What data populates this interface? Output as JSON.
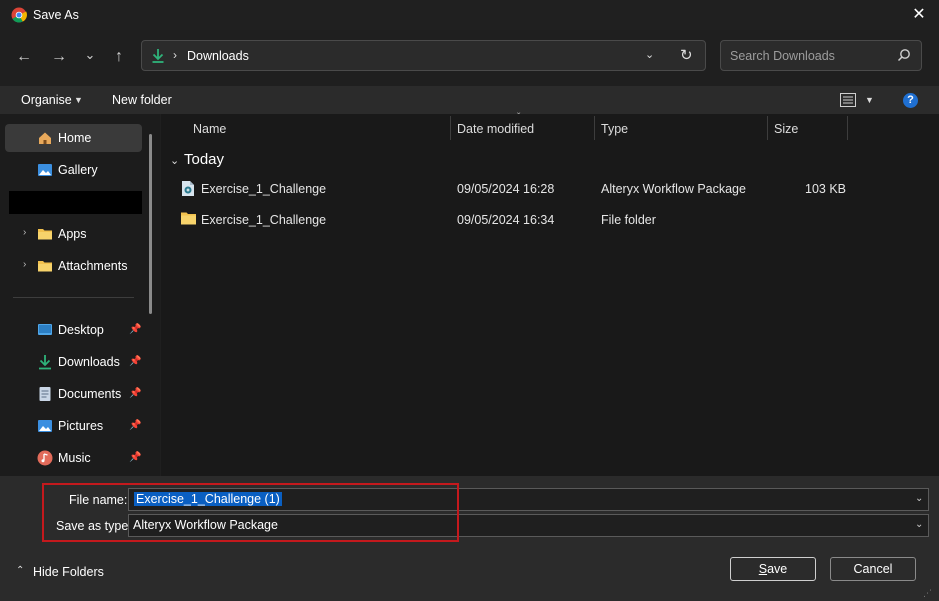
{
  "window": {
    "title": "Save As",
    "close_glyph": "✕",
    "icon": "chrome-icon"
  },
  "nav": {
    "back_glyph": "←",
    "forward_glyph": "→",
    "recent_glyph": "⌄",
    "up_glyph": "↑",
    "address": {
      "path_label": "Downloads",
      "sep_glyph": "›",
      "dropdown_glyph": "⌄",
      "refresh_glyph": "↻"
    },
    "search": {
      "placeholder": "Search Downloads",
      "icon": "search-icon"
    }
  },
  "toolbar": {
    "organise_label": "Organise",
    "caret_glyph": "▼",
    "new_folder_label": "New folder",
    "view_icon": "details-view-icon",
    "help_glyph": "?"
  },
  "sidebar": {
    "items": [
      {
        "label": "Home",
        "icon": "home-icon"
      },
      {
        "label": "Gallery",
        "icon": "gallery-icon"
      },
      {
        "label": "Apps",
        "icon": "folder-icon",
        "expandable": true
      },
      {
        "label": "Attachments",
        "icon": "folder-icon",
        "expandable": true
      },
      {
        "label": "Desktop",
        "icon": "desktop-icon",
        "pinned": true
      },
      {
        "label": "Downloads",
        "icon": "download-icon",
        "pinned": true
      },
      {
        "label": "Documents",
        "icon": "documents-icon",
        "pinned": true
      },
      {
        "label": "Pictures",
        "icon": "pictures-icon",
        "pinned": true
      },
      {
        "label": "Music",
        "icon": "music-icon",
        "pinned": true
      }
    ],
    "expand_glyph": "›",
    "pin_glyph": "📌"
  },
  "files": {
    "columns": [
      "Name",
      "Date modified",
      "Type",
      "Size"
    ],
    "sort_glyph": "ˇ",
    "group_label": "Today",
    "group_chev": "⌄",
    "rows": [
      {
        "name": "Exercise_1_Challenge",
        "date": "09/05/2024 16:28",
        "type": "Alteryx Workflow Package",
        "size": "103 KB",
        "icon": "alteryx-package-icon"
      },
      {
        "name": "Exercise_1_Challenge",
        "date": "09/05/2024 16:34",
        "type": "File folder",
        "size": "",
        "icon": "folder-icon"
      }
    ]
  },
  "form": {
    "file_name_label": "File name:",
    "file_name_value": "Exercise_1_Challenge (1)",
    "save_type_label": "Save as type:",
    "save_type_value": "Alteryx Workflow Package",
    "dropdown_glyph": "⌄",
    "highlight_color": "#c4191d"
  },
  "footer": {
    "hide_folders_label": "Hide Folders",
    "hide_caret": "⌃",
    "save_label_first": "S",
    "save_label_rest": "ave",
    "cancel_label": "Cancel"
  },
  "colors": {
    "selection": "#0a5fc2",
    "help": "#1f6fd1",
    "download_green": "#2fb37a"
  }
}
